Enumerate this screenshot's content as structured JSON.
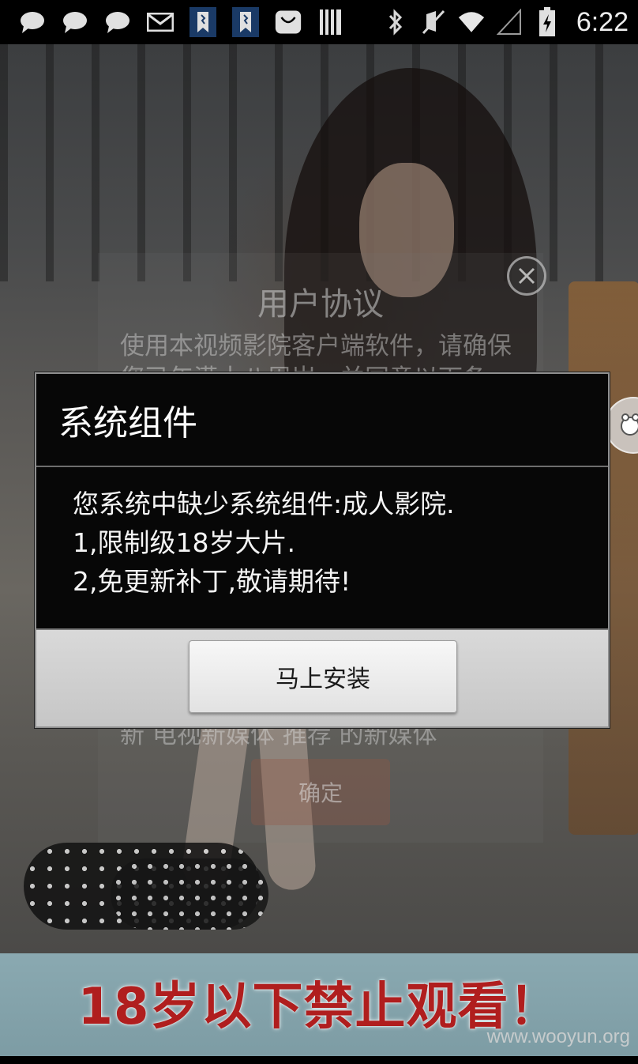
{
  "status_bar": {
    "time": "6:22",
    "left_icons": [
      "chat-bubble-icon",
      "chat-bubble-icon",
      "chat-bubble-icon",
      "mail-icon",
      "bookmark-app-icon",
      "bookmark-app-icon",
      "shopping-bag-icon",
      "barcode-icon"
    ],
    "right_icons": [
      "bluetooth-icon",
      "mute-icon",
      "wifi-icon",
      "signal-icon",
      "battery-charging-icon"
    ]
  },
  "agreement": {
    "title": "用户协议",
    "body": "使用本视频影院客户端软件，请确保您已年满十八周岁，并同意以下条款。以下为条款内容，请阅读条款内容，从本视频客户端观看任何内容均需遵守这些条款，下载此软件即表示同意。如您不接受这些条款，请勿使用本客户端，并请从您的手机或者其他设备上卸载本",
    "footer_partial": "新  电视新媒体  推荐  的新媒体",
    "ok_label": "确定"
  },
  "dialog": {
    "title": "系统组件",
    "message_lines": [
      "您系统中缺少系统组件:成人影院.",
      "1,限制级18岁大片.",
      "2,免更新补丁,敬请期待!"
    ],
    "install_label": "马上安装"
  },
  "banner": {
    "text": "18岁以下禁止观看！"
  },
  "watermark": "www.wooyun.org"
}
